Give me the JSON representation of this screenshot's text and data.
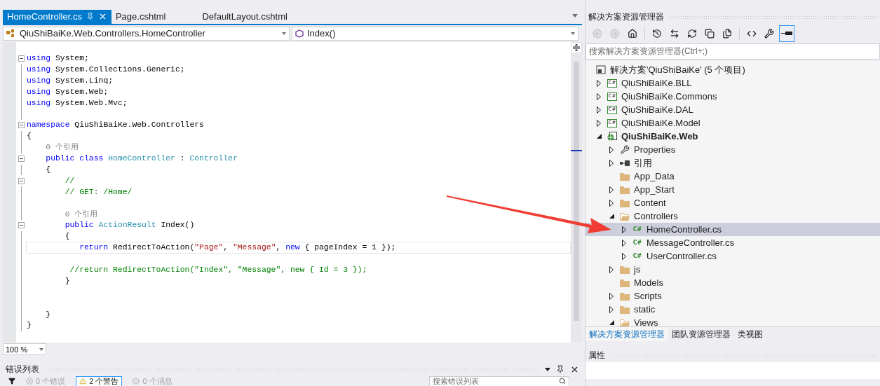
{
  "document_tabs": [
    {
      "label": "HomeController.cs",
      "selected": true
    },
    {
      "label": "Page.cshtml",
      "selected": false
    },
    {
      "label": "DefaultLayout.cshtml",
      "selected": false
    }
  ],
  "navigation_bar": {
    "type_dropdown": "QiuShiBaiKe.Web.Controllers.HomeController",
    "member_dropdown": "Index()"
  },
  "code_lines": [
    {
      "fold": true,
      "tokens": [
        {
          "kind": "keyword",
          "text": "using"
        },
        {
          "kind": "plain",
          "text": " System;"
        }
      ]
    },
    {
      "fold": false,
      "tokens": [
        {
          "kind": "keyword",
          "text": "using"
        },
        {
          "kind": "plain",
          "text": " System.Collections.Generic;"
        }
      ]
    },
    {
      "fold": false,
      "tokens": [
        {
          "kind": "keyword",
          "text": "using"
        },
        {
          "kind": "plain",
          "text": " System.Linq;"
        }
      ]
    },
    {
      "fold": false,
      "tokens": [
        {
          "kind": "keyword",
          "text": "using"
        },
        {
          "kind": "plain",
          "text": " System.Web;"
        }
      ]
    },
    {
      "fold": false,
      "tokens": [
        {
          "kind": "keyword",
          "text": "using"
        },
        {
          "kind": "plain",
          "text": " System.Web.Mvc;"
        }
      ]
    },
    {
      "fold": false
    },
    {
      "fold": true,
      "tokens": [
        {
          "kind": "keyword",
          "text": "namespace"
        },
        {
          "kind": "plain",
          "text": " QiuShiBaiKe.Web.Controllers"
        }
      ]
    },
    {
      "fold": false,
      "tokens": [
        {
          "kind": "plain",
          "text": "{"
        }
      ]
    },
    {
      "fold": false,
      "tokens": [
        {
          "kind": "reference",
          "text": "    0 个引用"
        }
      ]
    },
    {
      "fold": true,
      "tokens": [
        {
          "kind": "keyword",
          "text": "    public class "
        },
        {
          "kind": "type",
          "text": "HomeController"
        },
        {
          "kind": "plain",
          "text": " : "
        },
        {
          "kind": "type",
          "text": "Controller"
        }
      ]
    },
    {
      "fold": false,
      "tokens": [
        {
          "kind": "plain",
          "text": "    {"
        }
      ]
    },
    {
      "fold": true,
      "tokens": [
        {
          "kind": "comment",
          "text": "        //"
        }
      ]
    },
    {
      "fold": false,
      "tokens": [
        {
          "kind": "comment",
          "text": "        // GET: /Home/"
        }
      ]
    },
    {
      "fold": false
    },
    {
      "fold": false,
      "tokens": [
        {
          "kind": "reference",
          "text": "        0 个引用"
        }
      ]
    },
    {
      "fold": true,
      "tokens": [
        {
          "kind": "keyword",
          "text": "        public "
        },
        {
          "kind": "type",
          "text": "ActionResult"
        },
        {
          "kind": "plain",
          "text": " Index()"
        }
      ]
    },
    {
      "fold": false,
      "tokens": [
        {
          "kind": "plain",
          "text": "        {"
        }
      ]
    },
    {
      "fold": false,
      "current": true,
      "tokens": [
        {
          "kind": "keyword",
          "text": "           return"
        },
        {
          "kind": "plain",
          "text": " RedirectToAction("
        },
        {
          "kind": "string",
          "text": "\"Page\""
        },
        {
          "kind": "plain",
          "text": ", "
        },
        {
          "kind": "string",
          "text": "\"Message\""
        },
        {
          "kind": "plain",
          "text": ", "
        },
        {
          "kind": "keyword",
          "text": "new"
        },
        {
          "kind": "plain",
          "text": " { pageIndex = 1 });"
        }
      ]
    },
    {
      "fold": false
    },
    {
      "fold": false,
      "tokens": [
        {
          "kind": "comment",
          "text": "         //return RedirectToAction(\"Index\", \"Message\", new { Id = 3 });"
        }
      ]
    },
    {
      "fold": false,
      "tokens": [
        {
          "kind": "plain",
          "text": "        }"
        }
      ]
    },
    {
      "fold": false
    },
    {
      "fold": false
    },
    {
      "fold": false,
      "tokens": [
        {
          "kind": "plain",
          "text": "    }"
        }
      ]
    },
    {
      "fold": false,
      "tokens": [
        {
          "kind": "plain",
          "text": "}"
        }
      ]
    }
  ],
  "zoom": "100 %",
  "error_list": {
    "title": "错误列表",
    "filters": [
      {
        "kind": "error",
        "label": "0 个错误",
        "selected": false
      },
      {
        "kind": "warning",
        "label": "2 个警告",
        "selected": true
      },
      {
        "kind": "message",
        "label": "0 个消息",
        "selected": false
      }
    ],
    "search": {
      "placeholder": "搜索错误列表"
    }
  },
  "solution_explorer": {
    "title": "解决方案资源管理器",
    "toolbar": [
      {
        "kind": "back",
        "disabled": true
      },
      {
        "kind": "forward",
        "disabled": true
      },
      {
        "kind": "home",
        "disabled": false
      },
      {
        "kind": "history",
        "disabled": false
      },
      {
        "kind": "sync",
        "disabled": false
      },
      {
        "kind": "refresh",
        "disabled": false
      },
      {
        "kind": "collapse",
        "disabled": false
      },
      {
        "kind": "show-files",
        "disabled": false
      },
      {
        "kind": "code",
        "disabled": false
      },
      {
        "kind": "properties",
        "disabled": false
      },
      {
        "kind": "preview",
        "disabled": false,
        "selected": true
      }
    ],
    "search": {
      "placeholder": "搜索解决方案资源管理器(Ctrl+;)"
    },
    "tree": [
      {
        "label": "解决方案'QiuShiBaiKe' (5 个项目)",
        "kind": "solution",
        "selected": false,
        "children": [
          {
            "label": "QiuShiBaiKe.BLL",
            "kind": "csproject",
            "icon_label": "C#",
            "expanded": false,
            "selected": false
          },
          {
            "label": "QiuShiBaiKe.Commons",
            "kind": "csproject",
            "icon_label": "C#",
            "expanded": false,
            "selected": false
          },
          {
            "label": "QiuShiBaiKe.DAL",
            "kind": "csproject",
            "icon_label": "C#",
            "expanded": false,
            "selected": false
          },
          {
            "label": "QiuShiBaiKe.Model",
            "kind": "csproject",
            "icon_label": "C#",
            "expanded": false,
            "selected": false
          },
          {
            "label": "QiuShiBaiKe.Web",
            "kind": "webproject",
            "expanded": true,
            "selected": false,
            "bold": true,
            "children": [
              {
                "label": "Properties",
                "kind": "properties",
                "expanded": false,
                "selected": false
              },
              {
                "label": "引用",
                "kind": "references",
                "expanded": false,
                "selected": false
              },
              {
                "label": "App_Data",
                "kind": "folder",
                "selected": false
              },
              {
                "label": "App_Start",
                "kind": "folder",
                "expanded": false,
                "selected": false
              },
              {
                "label": "Content",
                "kind": "folder",
                "expanded": false,
                "selected": false
              },
              {
                "label": "Controllers",
                "kind": "open-folder",
                "expanded": true,
                "selected": false,
                "children": [
                  {
                    "label": "HomeController.cs",
                    "kind": "csfile",
                    "icon_label": "C#",
                    "expanded": false,
                    "selected": true
                  },
                  {
                    "label": "MessageController.cs",
                    "kind": "csfile",
                    "icon_label": "C#",
                    "expanded": false,
                    "selected": false
                  },
                  {
                    "label": "UserController.cs",
                    "kind": "csfile",
                    "icon_label": "C#",
                    "expanded": false,
                    "selected": false
                  }
                ]
              },
              {
                "label": "js",
                "kind": "folder",
                "expanded": false,
                "selected": false
              },
              {
                "label": "Models",
                "kind": "folder",
                "selected": false
              },
              {
                "label": "Scripts",
                "kind": "folder",
                "expanded": false,
                "selected": false
              },
              {
                "label": "static",
                "kind": "folder",
                "expanded": false,
                "selected": false
              },
              {
                "label": "Views",
                "kind": "open-folder",
                "expanded": true,
                "selected": false
              }
            ]
          }
        ]
      }
    ],
    "bottom_tabs": [
      {
        "label": "解决方案资源管理器",
        "selected": true
      },
      {
        "label": "团队资源管理器",
        "selected": false
      },
      {
        "label": "类视图",
        "selected": false
      }
    ]
  },
  "properties_panel": {
    "title": "属性"
  }
}
